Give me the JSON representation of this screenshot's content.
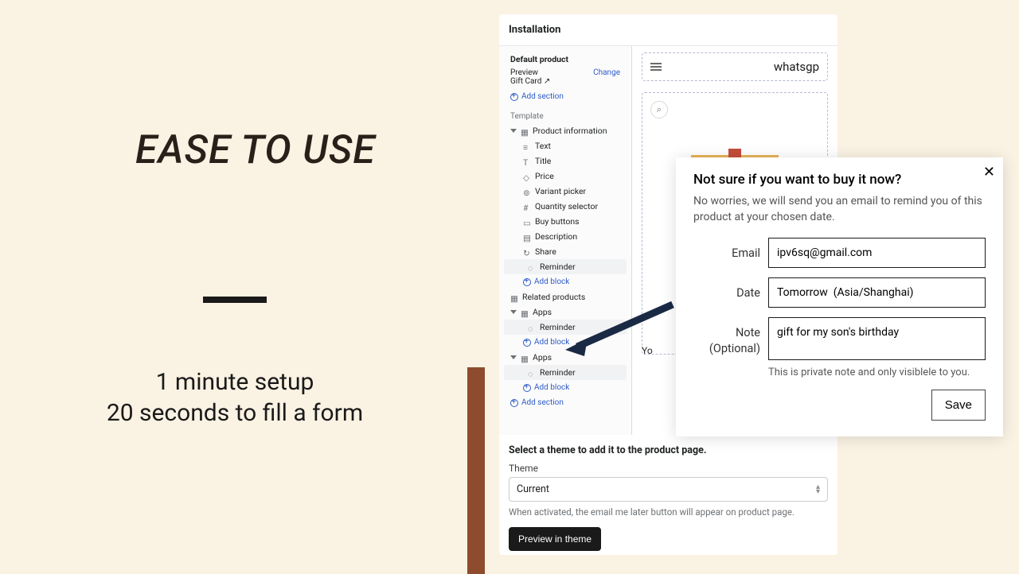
{
  "marketing": {
    "headline": "EASE TO USE",
    "line1": "1 minute setup",
    "line2": "20 seconds to fill a form"
  },
  "panel": {
    "title": "Installation",
    "default_product": "Default product",
    "preview_label": "Preview",
    "change": "Change",
    "gift_card": "Gift Card  ↗",
    "add_section": "Add section",
    "template_label": "Template",
    "tree": {
      "product_info": "Product information",
      "text": "Text",
      "title": "Title",
      "price": "Price",
      "variant": "Variant picker",
      "qty": "Quantity selector",
      "buy": "Buy buttons",
      "desc": "Description",
      "share": "Share",
      "reminder": "Reminder",
      "add_block": "Add block",
      "related": "Related products",
      "apps": "Apps"
    },
    "shop_title": "whatsgp",
    "you": "Yo"
  },
  "popup": {
    "title": "Not sure if you want to buy it now?",
    "desc": "No worries, we will send you an email to remind you of this product at your chosen date.",
    "email_label": "Email",
    "email_value": "ipv6sq@gmail.com",
    "date_label": "Date",
    "date_value": "Tomorrow  (Asia/Shanghai)",
    "note_label": "Note (Optional)",
    "note_value": "gift for my son's birthday",
    "private": "This is private note and only visiblele to you.",
    "save": "Save"
  },
  "theme": {
    "inst": "Select a theme to add it to the product page.",
    "label": "Theme",
    "value": "Current",
    "caption": "When activated, the email me later button will appear on product page.",
    "preview_btn": "Preview in theme"
  }
}
